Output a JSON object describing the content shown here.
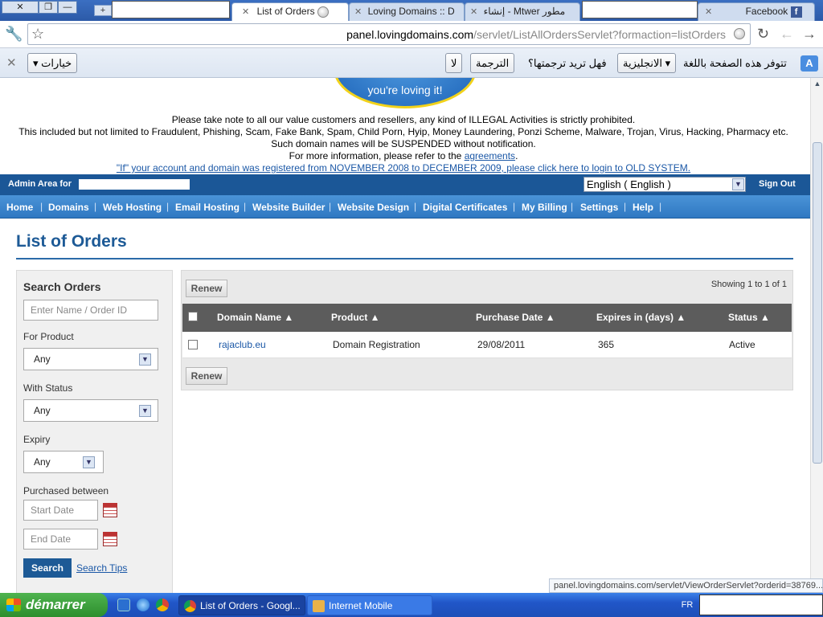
{
  "browser": {
    "window_buttons": [
      "✕",
      "❐",
      "—"
    ],
    "tabs": [
      {
        "title": "List of Orders",
        "active": true
      },
      {
        "title": "Loving Domains :: D",
        "active": false
      },
      {
        "title": "إنشاء - Mtwer مطور",
        "active": false
      },
      {
        "title": "Facebook",
        "active": false
      }
    ],
    "url_domain": "panel.lovingdomains.com",
    "url_path": "/servlet/ListAllOrdersServlet?formaction=listOrders"
  },
  "translate_bar": {
    "message": "تتوفر هذه الصفحة باللغة",
    "language": "الانجليزية",
    "question": "فهل تريد ترجمتها؟",
    "translate_button": "الترجمة",
    "no_button": "لا",
    "options_button": "خيارات"
  },
  "page": {
    "logo_tagline": "you're loving it!",
    "notice_lines": [
      "Please take note to all our value customers and resellers, any kind of ILLEGAL Activities is strictly prohibited.",
      "This included but not limited to Fraudulent, Phishing, Scam, Fake Bank, Spam, Child Porn, Hyip, Money Laundering, Ponzi Scheme, Malware, Trojan, Virus, Hacking, Pharmacy etc.",
      "Such domain names will be SUSPENDED without notification."
    ],
    "info_prefix": "For more information, please refer to the ",
    "info_link": "agreements",
    "info_suffix": ".",
    "old_system_link": "\"If\" your account and domain was registered from NOVEMBER 2008 to DECEMBER 2009, please click here to login to OLD SYSTEM.",
    "admin_label": "Admin Area for",
    "language_select": "English ( English )",
    "sign_out": "Sign Out",
    "nav": [
      "Home",
      "Domains",
      "Web Hosting",
      "Email Hosting",
      "Website Builder",
      "Website Design",
      "Digital Certificates",
      "My Billing",
      "Settings",
      "Help"
    ],
    "title": "List of Orders"
  },
  "search": {
    "heading": "Search Orders",
    "name_placeholder": "Enter Name / Order ID",
    "product_label": "For Product",
    "product_value": "Any",
    "status_label": "With Status",
    "status_value": "Any",
    "expiry_label": "Expiry",
    "expiry_value": "Any",
    "purchased_label": "Purchased between",
    "start_placeholder": "Start Date",
    "end_placeholder": "End Date",
    "search_button": "Search",
    "tips_link": "Search Tips"
  },
  "orders": {
    "renew_label": "Renew",
    "showing": "Showing 1 to 1 of 1",
    "columns": [
      "Domain Name ▲",
      "Product ▲",
      "Purchase Date ▲",
      "Expires in (days) ▲",
      "Status ▲"
    ],
    "rows": [
      {
        "domain": "rajaclub.eu",
        "product": "Domain Registration",
        "purchase_date": "29/08/2011",
        "expires_days": "365",
        "status": "Active"
      }
    ]
  },
  "status_bubble": "panel.lovingdomains.com/servlet/ViewOrderServlet?orderid=38769...",
  "taskbar": {
    "start": "démarrer",
    "items": [
      {
        "label": "List of Orders - Googl...",
        "active": true
      },
      {
        "label": "Internet Mobile",
        "active": false
      }
    ],
    "lang": "FR"
  }
}
